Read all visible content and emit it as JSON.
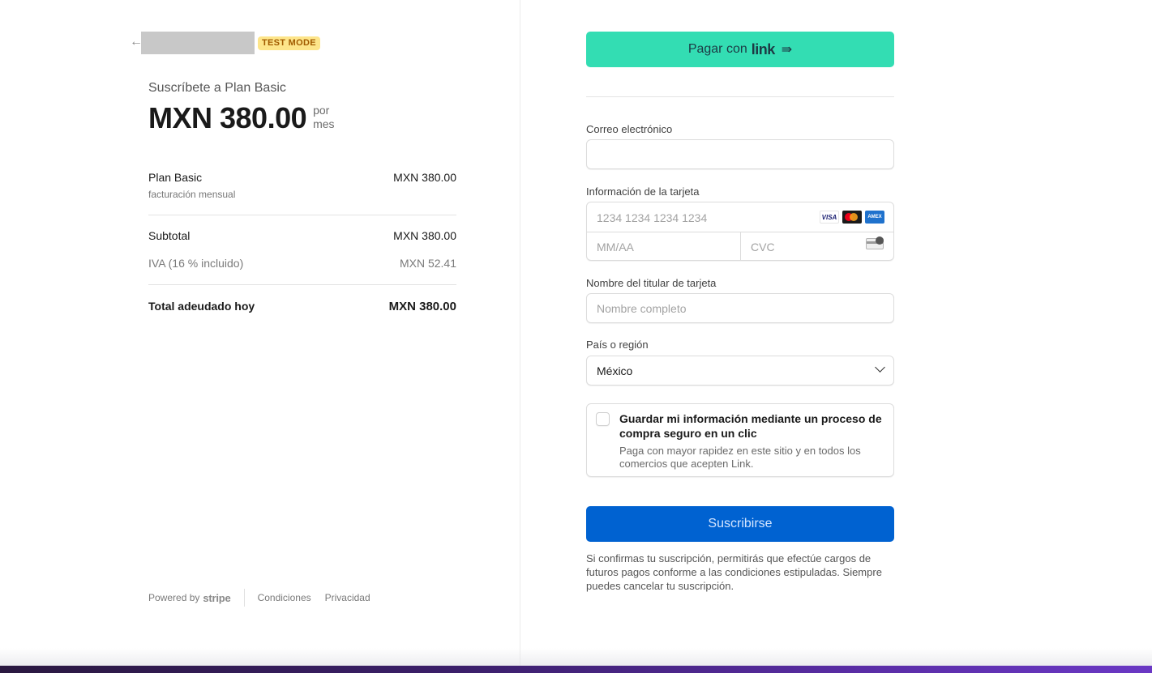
{
  "header": {
    "back_icon": "arrow-left-icon",
    "test_mode_badge": "TEST MODE"
  },
  "summary": {
    "title": "Suscríbete a Plan Basic",
    "price": "MXN 380.00",
    "period_line1": "por",
    "period_line2": "mes",
    "items": [
      {
        "name": "Plan Basic",
        "subtitle": "facturación mensual",
        "amount": "MXN 380.00"
      }
    ],
    "subtotal_label": "Subtotal",
    "subtotal_amount": "MXN 380.00",
    "tax_label": "IVA (16 % incluido)",
    "tax_amount": "MXN 52.41",
    "total_label": "Total adeudado hoy",
    "total_amount": "MXN 380.00"
  },
  "footer": {
    "powered_by": "Powered by",
    "brand": "stripe",
    "links": [
      "Condiciones",
      "Privacidad"
    ]
  },
  "payment": {
    "link_button_prefix": "Pagar con",
    "link_button_brand": "link",
    "link_button_arrow": "⇛",
    "email_label": "Correo electrónico",
    "email_value": "",
    "card_label": "Información de la tarjeta",
    "card_number_placeholder": "1234 1234 1234 1234",
    "expiry_placeholder": "MM/AA",
    "cvc_placeholder": "CVC",
    "card_brands": [
      "VISA",
      "mastercard",
      "AMEX"
    ],
    "cardholder_label": "Nombre del titular de tarjeta",
    "cardholder_placeholder": "Nombre completo",
    "country_label": "País o región",
    "country_value": "México",
    "save_title": "Guardar mi información mediante un proceso de compra seguro en un clic",
    "save_description": "Paga con mayor rapidez en este sitio y en todos los comercios que acepten Link.",
    "submit_label": "Suscribirse",
    "terms": "Si confirmas tu suscripción, permitirás que efectúe cargos de futuros pagos conforme a las condiciones estipuladas. Siempre puedes cancelar tu suscripción."
  },
  "colors": {
    "link_green": "#33ddb3",
    "submit_blue": "#0062d1",
    "test_badge_bg": "#fde58a",
    "test_badge_text": "#a15b00"
  }
}
